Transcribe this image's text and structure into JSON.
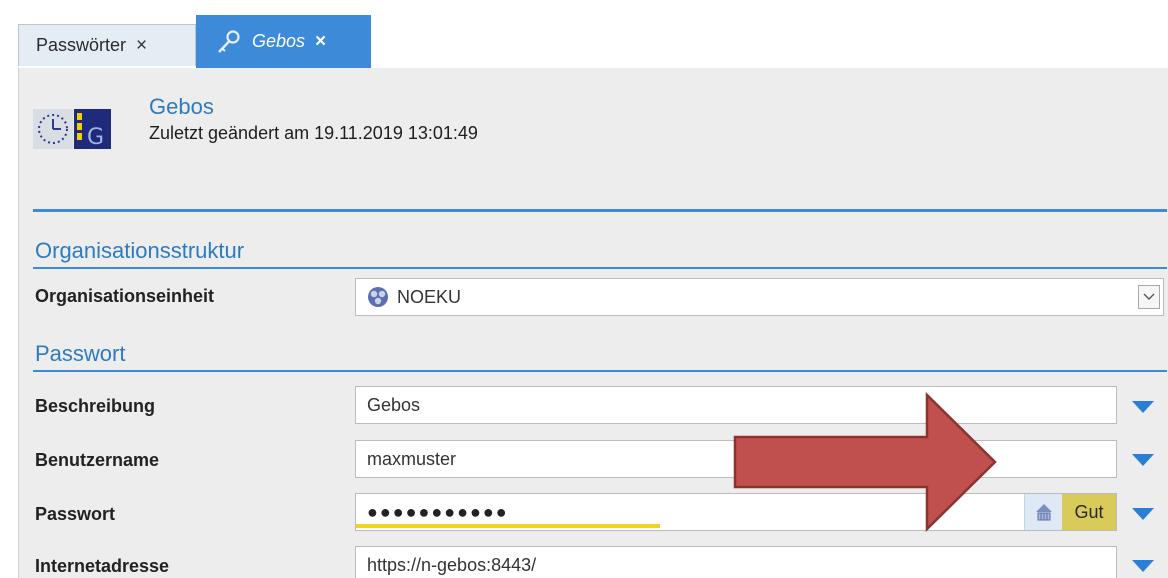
{
  "tabs": [
    {
      "label": "Passwörter",
      "close": "×"
    },
    {
      "label": "Gebos",
      "close": "×"
    }
  ],
  "header": {
    "title": "Gebos",
    "subtitle": "Zuletzt geändert am 19.11.2019 13:01:49"
  },
  "sections": {
    "org": "Organisationsstruktur",
    "password": "Passwort"
  },
  "fields": {
    "org_unit": {
      "label": "Organisationseinheit",
      "value": "NOEKU"
    },
    "description": {
      "label": "Beschreibung",
      "value": "Gebos"
    },
    "username": {
      "label": "Benutzername",
      "value": "maxmuster"
    },
    "password": {
      "label": "Passwort",
      "value": "●●●●●●●●●●●",
      "strength": "Gut",
      "strength_level": 0.4
    },
    "url": {
      "label": "Internetadresse",
      "value": "https://n-gebos:8443/"
    }
  },
  "colors": {
    "accent": "#3c8ad8",
    "strength_bar": "#f5d21c",
    "strength_badge": "#d9cb5a",
    "arrow": "#c0504d"
  },
  "icons": [
    "key-icon",
    "gebos-logo-icon",
    "org-unit-icon",
    "password-generator-icon",
    "dropdown-triangle-icon",
    "chevron-down-icon"
  ]
}
